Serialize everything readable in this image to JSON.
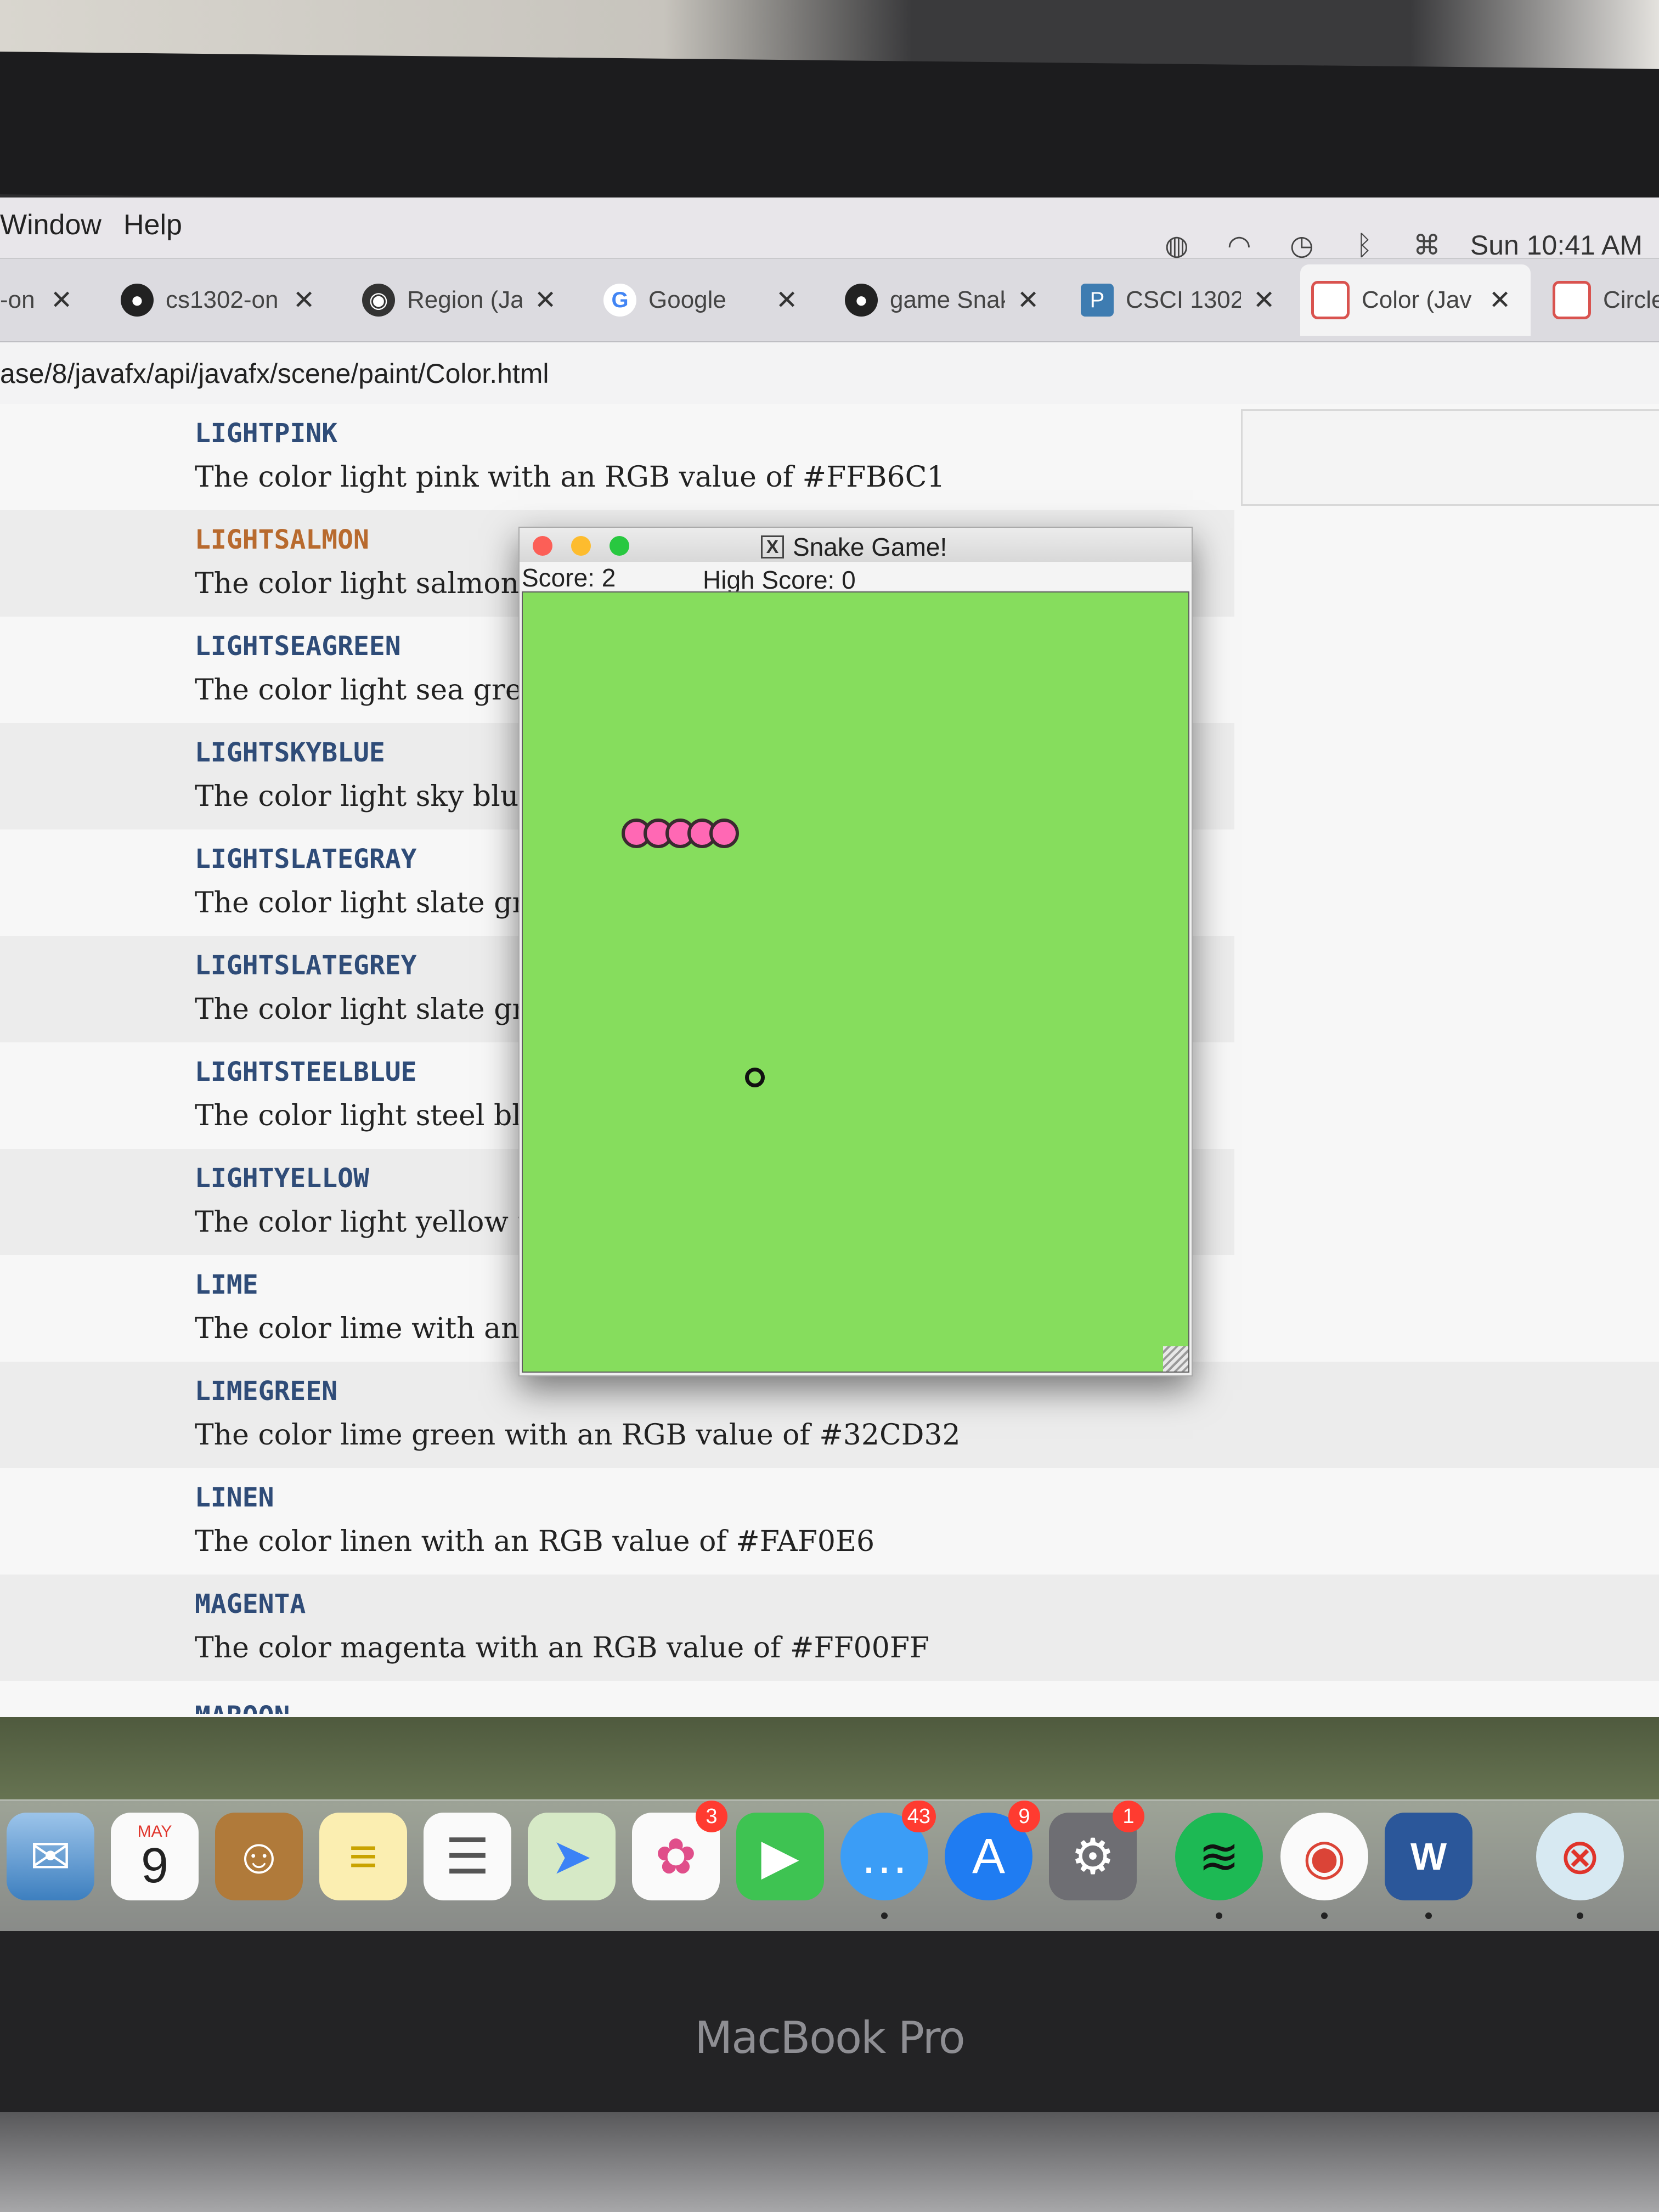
{
  "laptop_label": "MacBook Pro",
  "menubar": {
    "items": [
      "Window",
      "Help"
    ],
    "clock": "Sun 10:41 AM",
    "status_icons": [
      "cisco-anyconnect-icon",
      "wifi-icon",
      "time-machine-icon",
      "bluetooth-icon",
      "keyboard-viewer-icon"
    ]
  },
  "tabs": [
    {
      "title": "-on",
      "icon": "generic"
    },
    {
      "title": "cs1302-on",
      "icon": "github-icon"
    },
    {
      "title": "Region (Ja",
      "icon": "globe-icon"
    },
    {
      "title": "Google",
      "icon": "google-icon"
    },
    {
      "title": "game Snak",
      "icon": "github-icon"
    },
    {
      "title": "CSCI 1302",
      "icon": "piazza-icon"
    },
    {
      "title": "Color (Jav",
      "icon": "oracle-icon"
    },
    {
      "title": "Circle",
      "icon": "oracle-icon"
    }
  ],
  "address_bar": {
    "url": "ase/8/javafx/api/javafx/scene/paint/Color.html"
  },
  "entries": [
    {
      "name": "LIGHTPINK",
      "desc": "The color light pink with an RGB value of #FFB6C1"
    },
    {
      "name": "LIGHTSALMON",
      "desc": "The color light salmon"
    },
    {
      "name": "LIGHTSEAGREEN",
      "desc": "The color light sea gree"
    },
    {
      "name": "LIGHTSKYBLUE",
      "desc": "The color light sky blue"
    },
    {
      "name": "LIGHTSLATEGRAY",
      "desc": "The color light slate gra"
    },
    {
      "name": "LIGHTSLATEGREY",
      "desc": "The color light slate gre"
    },
    {
      "name": "LIGHTSTEELBLUE",
      "desc": "The color light steel blu"
    },
    {
      "name": "LIGHTYELLOW",
      "desc": "The color light yellow w"
    },
    {
      "name": "LIME",
      "desc": "The color lime with an"
    },
    {
      "name": "LIMEGREEN",
      "desc": "The color lime green with an RGB value of #32CD32"
    },
    {
      "name": "LINEN",
      "desc": "The color linen with an RGB value of #FAF0E6"
    },
    {
      "name": "MAGENTA",
      "desc": "The color magenta with an RGB value of #FF00FF"
    },
    {
      "name": "MAROON",
      "desc": ""
    }
  ],
  "game": {
    "title": "Snake Game!",
    "score_text": "Score: 2",
    "high_score_text": "High Score: 0",
    "score": 2,
    "high_score": 0,
    "snake_segments": 5,
    "board_color": "#86dd5d",
    "snake_color": "#ff68b4"
  },
  "dock": {
    "apps": [
      {
        "name": "mail-icon"
      },
      {
        "name": "calendar-icon",
        "month": "MAY",
        "day": "9"
      },
      {
        "name": "contacts-icon"
      },
      {
        "name": "notes-icon"
      },
      {
        "name": "reminders-icon"
      },
      {
        "name": "maps-icon"
      },
      {
        "name": "photos-icon",
        "badge": "3"
      },
      {
        "name": "facetime-icon"
      },
      {
        "name": "messages-icon",
        "badge": "43"
      },
      {
        "name": "app-store-icon",
        "badge": "9"
      },
      {
        "name": "system-preferences-icon",
        "badge": "1"
      },
      {
        "name": "spotify-icon"
      },
      {
        "name": "chrome-icon"
      },
      {
        "name": "word-icon",
        "letter": "W"
      },
      {
        "name": "cisco-anyconnect-icon"
      }
    ]
  }
}
